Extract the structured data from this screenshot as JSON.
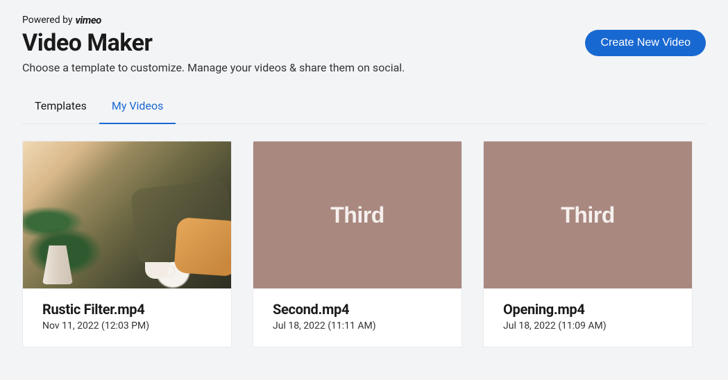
{
  "header": {
    "powered_by_prefix": "Powered by",
    "powered_by_brand": "vimeo",
    "title": "Video Maker",
    "create_button": "Create New Video",
    "subtitle": "Choose a template to customize. Manage your videos & share them on social."
  },
  "tabs": {
    "templates": "Templates",
    "my_videos": "My Videos",
    "active": "my_videos"
  },
  "videos": [
    {
      "title": "Rustic Filter.mp4",
      "date": "Nov 11, 2022 (12:03 PM)",
      "thumb_style": "rustic",
      "overlay_text": ""
    },
    {
      "title": "Second.mp4",
      "date": "Jul 18, 2022 (11:11 AM)",
      "thumb_style": "solid",
      "overlay_text": "Third"
    },
    {
      "title": "Opening.mp4",
      "date": "Jul 18, 2022 (11:09 AM)",
      "thumb_style": "solid",
      "overlay_text": "Third"
    }
  ],
  "colors": {
    "accent": "#1868d1",
    "thumb_solid": "#a98880",
    "page_bg": "#f3f4f6"
  }
}
